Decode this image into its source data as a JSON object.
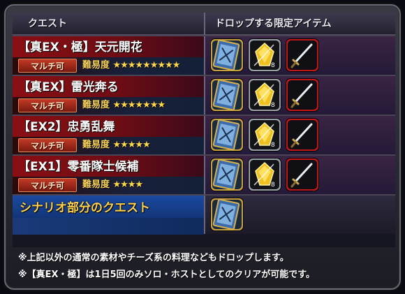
{
  "header": {
    "quest_label": "クエスト",
    "drop_label": "ドロップする限定アイテム"
  },
  "quests": [
    {
      "title": "【真EX・極】天元開花",
      "multi": "マルチ可",
      "difficulty_label": "難易度",
      "stars": "★★★★★★★★★",
      "star_count": 9,
      "drops": [
        "blue-card-icon",
        "gold-crystal-icon",
        "sword-icon"
      ]
    },
    {
      "title": "【真EX】雷光奔る",
      "multi": "マルチ可",
      "difficulty_label": "難易度",
      "stars": "★★★★★★★",
      "star_count": 7,
      "drops": [
        "blue-card-icon",
        "gold-crystal-icon",
        "sword-icon"
      ]
    },
    {
      "title": "【EX2】忠勇乱舞",
      "multi": "マルチ可",
      "difficulty_label": "難易度",
      "stars": "★★★★★",
      "star_count": 5,
      "drops": [
        "blue-card-icon",
        "gold-crystal-icon",
        "sword-icon"
      ]
    },
    {
      "title": "【EX1】零番隊士候補",
      "multi": "マルチ可",
      "difficulty_label": "難易度",
      "stars": "★★★★",
      "star_count": 4,
      "drops": [
        "blue-card-icon",
        "gold-crystal-icon",
        "sword-icon"
      ]
    }
  ],
  "scenario": {
    "title": "シナリオ部分のクエスト",
    "drops": [
      "blue-card-icon"
    ]
  },
  "notes": [
    "※上記以外の通常の素材やチーズ系の料理などもドロップします。",
    "※【真EX・極】は1日5回のみソロ・ホストとしてのクリアが可能です。"
  ],
  "colors": {
    "quest_row_red": "#8a0f14",
    "scenario_blue": "#1b4aa0",
    "star_gold": "#ffd84a",
    "badge_red": "#c23a26"
  }
}
